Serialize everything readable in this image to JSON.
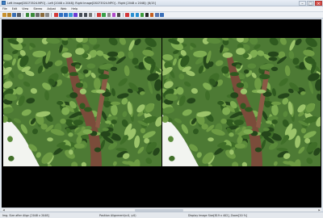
{
  "window": {
    "title": "Left Image[DSCF3524.MPO] - Left [2048 x 2048]: Right Image[DSCF3524.MPO] - Right [2048 x 2048]: [6/15]",
    "controls": [
      "–",
      "□",
      "×"
    ]
  },
  "menu": [
    "File",
    "Edit",
    "View",
    "Stereo",
    "Adjust",
    "Web",
    "Help"
  ],
  "toolbar": {
    "icons": [
      {
        "name": "open-icon",
        "color": "#c9922f"
      },
      {
        "name": "open-left-right-icon",
        "color": "#b5832a"
      },
      {
        "name": "save-icon",
        "color": "#3b6fb3"
      },
      {
        "name": "print-icon",
        "color": "#555d66"
      },
      {
        "name": "previous-icon",
        "color": "#3a8a3a"
      },
      {
        "name": "next-icon",
        "color": "#3a8a3a"
      },
      {
        "name": "swap-icon",
        "color": "#6b6b6b"
      },
      {
        "name": "edit-icon",
        "color": "#8a6a3a"
      },
      {
        "name": "rotate-icon",
        "color": "#8a8a8a"
      },
      {
        "name": "anaglyph-icon",
        "color": "#d43a3a"
      },
      {
        "name": "side-by-side-icon",
        "color": "#2f6fc2"
      },
      {
        "name": "over-under-icon",
        "color": "#2f6fc2"
      },
      {
        "name": "interlaced-icon",
        "color": "#3a9ad4"
      },
      {
        "name": "mirror-icon",
        "color": "#6a3ad4"
      },
      {
        "name": "left-only-icon",
        "color": "#444b55"
      },
      {
        "name": "right-only-icon",
        "color": "#444b55"
      },
      {
        "name": "mono-icon",
        "color": "#777777"
      },
      {
        "name": "red-cyan-icon",
        "color": "#d13b3b"
      },
      {
        "name": "color-icon",
        "color": "#3aa04a"
      },
      {
        "name": "gray-icon",
        "color": "#8c8c8c"
      },
      {
        "name": "flip-icon",
        "color": "#b04ac9"
      },
      {
        "name": "crop-icon",
        "color": "#4a4a4a"
      },
      {
        "name": "align-icon",
        "color": "#d4373a"
      },
      {
        "name": "zoom-in-icon",
        "color": "#2a8fd1"
      },
      {
        "name": "zoom-out-icon",
        "color": "#2a8fd1"
      },
      {
        "name": "fit-icon",
        "color": "#3a9a3a"
      },
      {
        "name": "full-screen-icon",
        "color": "#2a2a2a"
      },
      {
        "name": "slideshow-icon",
        "color": "#c45e1e"
      },
      {
        "name": "help-icon",
        "color": "#5a78b0"
      },
      {
        "name": "web-icon",
        "color": "#3a6fb8"
      }
    ]
  },
  "status": {
    "image_size": "Img. Size after Align [2048 x 2048]",
    "position": "Position Alignment(x:0, y:0)",
    "display": "Display Image Size[819 x 402], Zoom[20 %]"
  },
  "images": {
    "left": {
      "label": "left-image"
    },
    "right": {
      "label": "right-image"
    }
  },
  "colors": {
    "background": "#000000",
    "foliage_dark": "#2f5a1f",
    "foliage_light": "#7fae52",
    "trunk": "#7a4c3a",
    "sky": "#f2f4f0"
  }
}
